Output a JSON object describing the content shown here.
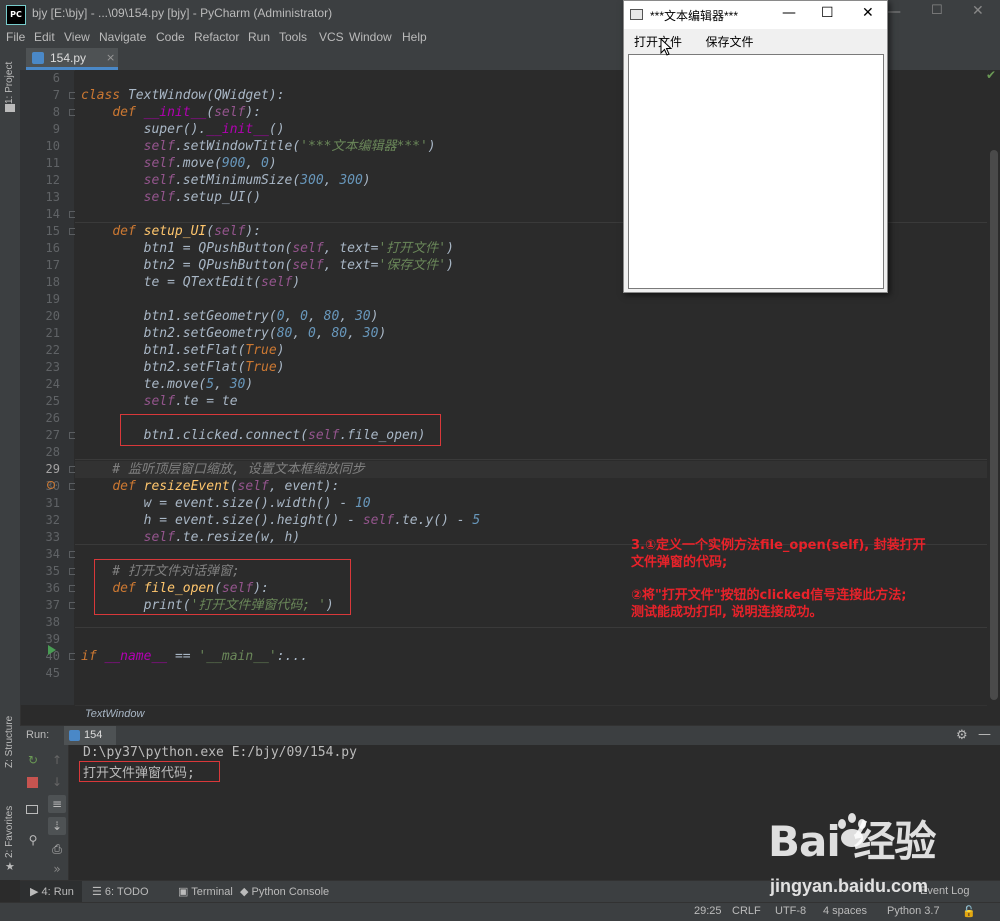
{
  "window": {
    "app_icon": "PC",
    "title": "bjy [E:\\bjy] - ...\\09\\154.py [bjy] - PyCharm (Administrator)"
  },
  "menu": [
    "File",
    "Edit",
    "View",
    "Navigate",
    "Code",
    "Refactor",
    "Run",
    "Tools",
    "VCS",
    "Window",
    "Help"
  ],
  "side_labels": {
    "project": "1: Project",
    "structure": "Z: Structure",
    "favorites": "2: Favorites"
  },
  "editor_tab": {
    "label": "154.py",
    "close": "×"
  },
  "gutter_numbers": [
    "6",
    "7",
    "8",
    "9",
    "10",
    "11",
    "12",
    "13",
    "14",
    "15",
    "16",
    "17",
    "18",
    "19",
    "20",
    "21",
    "22",
    "23",
    "24",
    "25",
    "26",
    "27",
    "28",
    "29",
    "30",
    "31",
    "32",
    "33",
    "34",
    "35",
    "36",
    "37",
    "38",
    "39",
    "40",
    "45"
  ],
  "code": [
    "",
    "class TextWindow(QWidget):",
    "    def __init__(self):",
    "        super().__init__()",
    "        self.setWindowTitle('***文本编辑器***')",
    "        self.move(900, 0)",
    "        self.setMinimumSize(300, 300)",
    "        self.setup_UI()",
    "",
    "    def setup_UI(self):",
    "        btn1 = QPushButton(self, text='打开文件')",
    "        btn2 = QPushButton(self, text='保存文件')",
    "        te = QTextEdit(self)",
    "",
    "        btn1.setGeometry(0, 0, 80, 30)",
    "        btn2.setGeometry(80, 0, 80, 30)",
    "        btn1.setFlat(True)",
    "        btn2.setFlat(True)",
    "        te.move(5, 30)",
    "        self.te = te",
    "",
    "        btn1.clicked.connect(self.file_open)",
    "",
    "    # 监听顶层窗口缩放, 设置文本框缩放同步",
    "    def resizeEvent(self, event):",
    "        w = event.size().width() - 10",
    "        h = event.size().height() - self.te.y() - 5",
    "        self.te.resize(w, h)",
    "",
    "    # 打开文件对话弹窗;",
    "    def file_open(self):",
    "        print('打开文件弹窗代码; ')",
    "",
    "",
    "if __name__ == '__main__':...",
    ""
  ],
  "annotation": {
    "line1": "3.①定义一个实例方法file_open(self), 封装打开",
    "line2": "文件弹窗的代码;",
    "line3": "②将\"打开文件\"按钮的clicked信号连接此方法;",
    "line4": "测试能成功打印, 说明连接成功。"
  },
  "breadcrumb": "TextWindow",
  "run_panel": {
    "label": "Run:",
    "tab": "154",
    "output": [
      "D:\\py37\\python.exe E:/bjy/09/154.py",
      "打开文件弹窗代码;"
    ]
  },
  "bottom_tools": [
    "4: Run",
    "6: TODO",
    "Terminal",
    "Python Console"
  ],
  "status": {
    "position": "29:25",
    "line_sep": "CRLF",
    "encoding": "UTF-8",
    "indent": "4 spaces",
    "interpreter": "Python 3.7",
    "event_log": "Event Log"
  },
  "qt_window": {
    "title": "***文本编辑器***",
    "btn_open": "打开文件",
    "btn_save": "保存文件",
    "minimize": "—",
    "maximize": "☐",
    "close": "✕"
  },
  "watermark": {
    "logo": "Bai  经验",
    "url": "jingyan.baidu.com"
  },
  "colors": {
    "keyword": "#cc7832",
    "function": "#ffc66d",
    "self": "#94558d",
    "string": "#6a8759",
    "number": "#6897bb",
    "comment": "#808080",
    "annotation": "#e8222a",
    "highlight_box": "#d9383a"
  }
}
